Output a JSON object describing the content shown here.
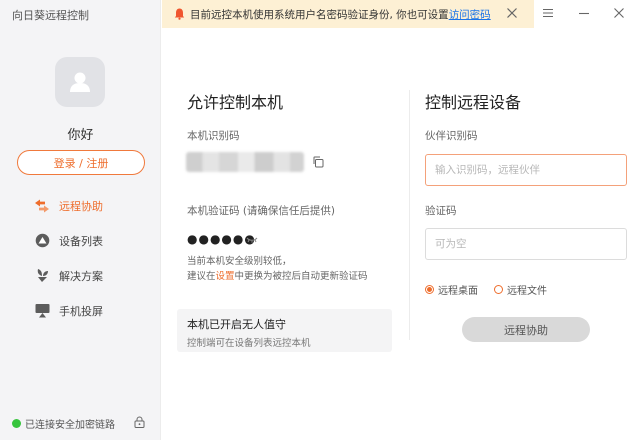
{
  "app": {
    "title": "向日葵远程控制"
  },
  "colors": {
    "accent": "#ee6d2c",
    "banner_bg": "#fdf0d4",
    "link": "#1a73e8",
    "online": "#37c43d"
  },
  "banner": {
    "text": "目前远控本机使用系统用户名密码验证身份, 你也可设置",
    "link": "访问密码"
  },
  "sidebar": {
    "greeting": "你好",
    "login_label": "登录 / 注册",
    "items": [
      {
        "label": "远程协助",
        "icon": "remote-assist-icon",
        "active": true
      },
      {
        "label": "设备列表",
        "icon": "device-list-icon",
        "active": false
      },
      {
        "label": "解决方案",
        "icon": "solution-icon",
        "active": false
      },
      {
        "label": "手机投屏",
        "icon": "screen-cast-icon",
        "active": false
      }
    ],
    "status": "已连接安全加密链路"
  },
  "allow": {
    "title": "允许控制本机",
    "id_label": "本机识别码",
    "code_label": "本机验证码 (请确保信任后提供)",
    "code_mask": "●●●●●●",
    "hint_line1": "当前本机安全级别较低，",
    "hint_pre": "建议在",
    "hint_link": "设置",
    "hint_post": "中更换为被控后自动更新验证码",
    "unattended_title": "本机已开启无人值守",
    "unattended_desc": "控制端可在设备列表远控本机"
  },
  "control": {
    "title": "控制远程设备",
    "partner_label": "伙伴识别码",
    "partner_placeholder": "输入识别码，远程伙伴",
    "code_label": "验证码",
    "code_placeholder": "可为空",
    "option_desktop": "远程桌面",
    "option_file": "远程文件",
    "connect_label": "远程协助"
  }
}
